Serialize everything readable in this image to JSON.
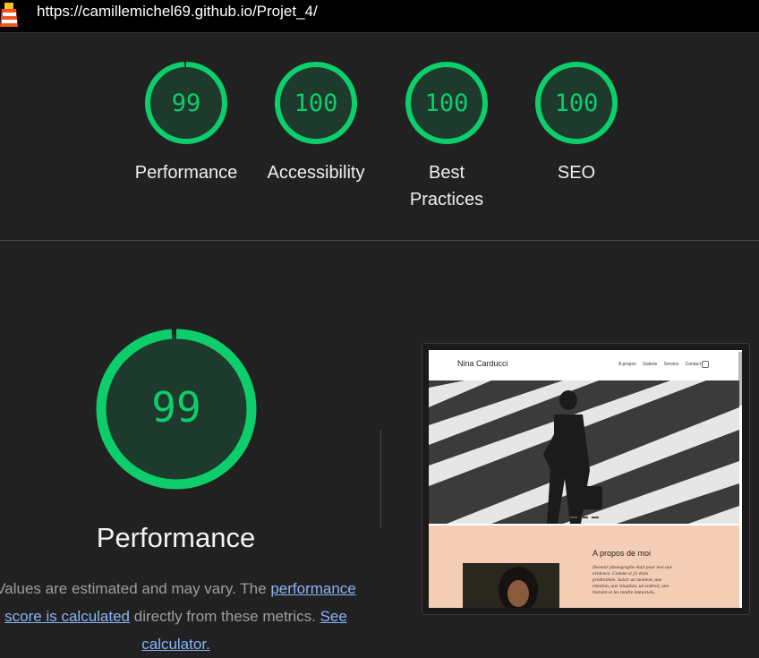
{
  "url": "https://camillemichel69.github.io/Projet_4/",
  "colors": {
    "pass": "#0cce6b",
    "ring_fill": "#1e3a2c",
    "link": "#8ab4f8"
  },
  "gauges": [
    {
      "score": "99",
      "label": "Performance",
      "fraction": 0.99
    },
    {
      "score": "100",
      "label": "Accessibility",
      "fraction": 1.0
    },
    {
      "score": "100",
      "label": "Best\nPractices",
      "fraction": 1.0
    },
    {
      "score": "100",
      "label": "SEO",
      "fraction": 1.0
    }
  ],
  "performance": {
    "score": "99",
    "fraction": 0.99,
    "title": "Performance",
    "desc_1": "Values are estimated and may vary. The ",
    "link_1": "performance score is calculated",
    "desc_2": " directly from these metrics. ",
    "link_2": "See calculator."
  },
  "thumbnail": {
    "site_name": "Nina Carducci",
    "nav_links": [
      "A propos",
      "Galerie",
      "Service",
      "Contact"
    ],
    "section_title": "A propos de moi",
    "section_text": "Devenir photographe était pour moi une évidence. Comme si j'y étais prédestinée. Saisir un moment, une émotion, une situation, un endroit, une histoire et les rendre immortels,"
  }
}
